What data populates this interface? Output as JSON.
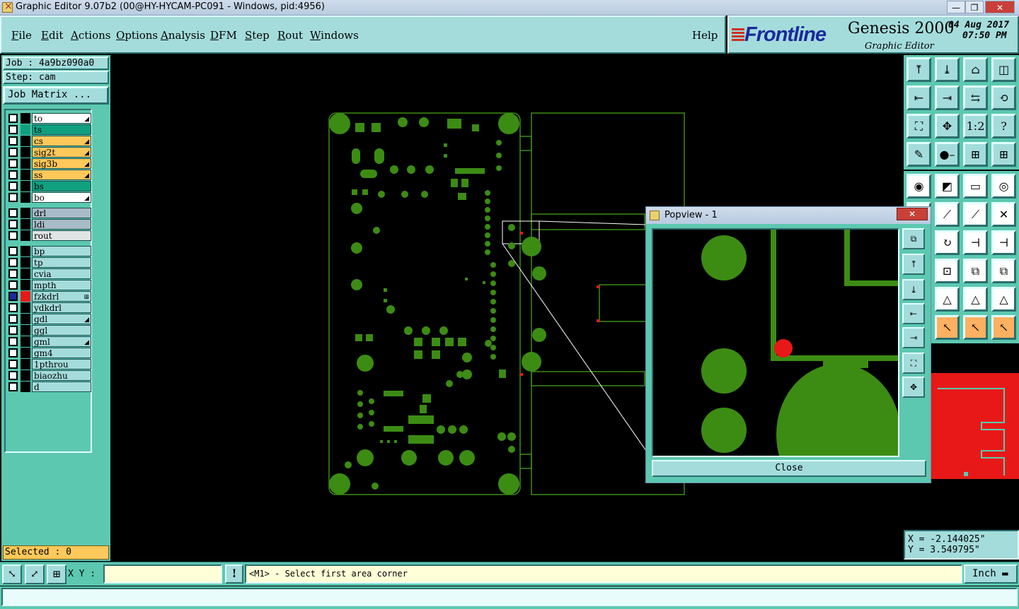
{
  "window": {
    "title": "Graphic Editor 9.07b2 (00@HY-HYCAM-PC091 - Windows, pid:4956)",
    "minimize": "—",
    "maximize": "❐",
    "close": "✕"
  },
  "menu": {
    "items": [
      "File",
      "Edit",
      "Actions",
      "Options",
      "Analysis",
      "DFM",
      "Step",
      "Rout",
      "Windows"
    ],
    "underlines": [
      "F",
      "E",
      "A",
      "O",
      "A",
      "D",
      "S",
      "R",
      "W"
    ],
    "help": "Help"
  },
  "brand": {
    "logo": "Frontline",
    "product": "Genesis 2000",
    "subtitle": "Graphic Editor",
    "date": "04 Aug 2017",
    "time": "07:50 PM"
  },
  "job": {
    "job_label": "Job : 4a9bz090a0",
    "step_label": "Step: cam",
    "matrix_button": "Job Matrix ..."
  },
  "layers": [
    {
      "name": "to",
      "color": "#ffffff",
      "swatch": "#000000",
      "mark": "◢"
    },
    {
      "name": "ts",
      "color": "#10a080",
      "swatch": "#10a080",
      "mark": ""
    },
    {
      "name": "cs",
      "color": "#ffc85a",
      "swatch": "#000000",
      "mark": "◢"
    },
    {
      "name": "sig2t",
      "color": "#ffc85a",
      "swatch": "#000000",
      "mark": "◢"
    },
    {
      "name": "sig3b",
      "color": "#ffc85a",
      "swatch": "#000000",
      "mark": "◢"
    },
    {
      "name": "ss",
      "color": "#ffc85a",
      "swatch": "#000000",
      "mark": "◢"
    },
    {
      "name": "bs",
      "color": "#10a080",
      "swatch": "#000000",
      "mark": ""
    },
    {
      "name": "bo",
      "color": "#ffffff",
      "swatch": "#000000",
      "mark": "◢"
    },
    {
      "name": "drl",
      "color": "#a8bcc8",
      "swatch": "#000000",
      "mark": ""
    },
    {
      "name": "ldi",
      "color": "#a8bcc8",
      "swatch": "#000000",
      "mark": ""
    },
    {
      "name": "rout",
      "color": "#e0e4e4",
      "swatch": "#000000",
      "mark": ""
    },
    {
      "name": "bp",
      "color": "#a4dcdc",
      "swatch": "#000000",
      "mark": ""
    },
    {
      "name": "tp",
      "color": "#a4dcdc",
      "swatch": "#000000",
      "mark": ""
    },
    {
      "name": "cvia",
      "color": "#a4dcdc",
      "swatch": "#000000",
      "mark": ""
    },
    {
      "name": "mpth",
      "color": "#a4dcdc",
      "swatch": "#000000",
      "mark": ""
    },
    {
      "name": "fzkdrl",
      "color": "#a4dcdc",
      "swatch": "#e81818",
      "mark": "⊞"
    },
    {
      "name": "ydkdrl",
      "color": "#a4dcdc",
      "swatch": "#000000",
      "mark": ""
    },
    {
      "name": "gdl",
      "color": "#a4dcdc",
      "swatch": "#000000",
      "mark": "◢"
    },
    {
      "name": "ggl",
      "color": "#a4dcdc",
      "swatch": "#000000",
      "mark": ""
    },
    {
      "name": "gml",
      "color": "#a4dcdc",
      "swatch": "#000000",
      "mark": "◢"
    },
    {
      "name": "gm4",
      "color": "#a4dcdc",
      "swatch": "#000000",
      "mark": ""
    },
    {
      "name": "1pthrou",
      "color": "#a4dcdc",
      "swatch": "#000000",
      "mark": ""
    },
    {
      "name": "biaozhu",
      "color": "#a4dcdc",
      "swatch": "#000000",
      "mark": ""
    },
    {
      "name": "d",
      "color": "#a4dcdc",
      "swatch": "#000000",
      "mark": ""
    }
  ],
  "selected": "Selected : 0",
  "coords": {
    "x": "X = -2.144025\"",
    "y": "Y =  3.549795\""
  },
  "popview": {
    "title": "Popview - 1",
    "close_button": "Close",
    "close_x": "✕"
  },
  "bottom": {
    "xy_label": "X Y :",
    "xy_value": "",
    "warn": "!",
    "prompt": "<M1> - Select first area corner",
    "units": "Inch ▬"
  },
  "status": {
    "message": ""
  },
  "toolbar_icons": {
    "row1": [
      "⤒",
      "⤓",
      "⌂",
      "◫"
    ],
    "row2": [
      "⇤",
      "⇥",
      "⇆",
      "⟲"
    ],
    "row3": [
      "⛶",
      "✥",
      "1:2",
      "?"
    ],
    "row4": [
      "✎",
      "●–",
      "⊞",
      "⊞"
    ],
    "row5": [
      "◉",
      "◩",
      "▭",
      "◎"
    ],
    "row6": [
      "✕",
      "⟋",
      "⟋",
      "✕"
    ],
    "row7": [
      "⟋",
      "↻",
      "⊣",
      "⊣"
    ],
    "row8": [
      "—",
      "⊡",
      "⧉",
      "⧉"
    ],
    "row9": [
      "△",
      "△",
      "△",
      "△"
    ],
    "row10": [
      "↖",
      "↖",
      "↖",
      "↖"
    ]
  },
  "accent": "#5cc8b0",
  "copper": "#3c8c14"
}
